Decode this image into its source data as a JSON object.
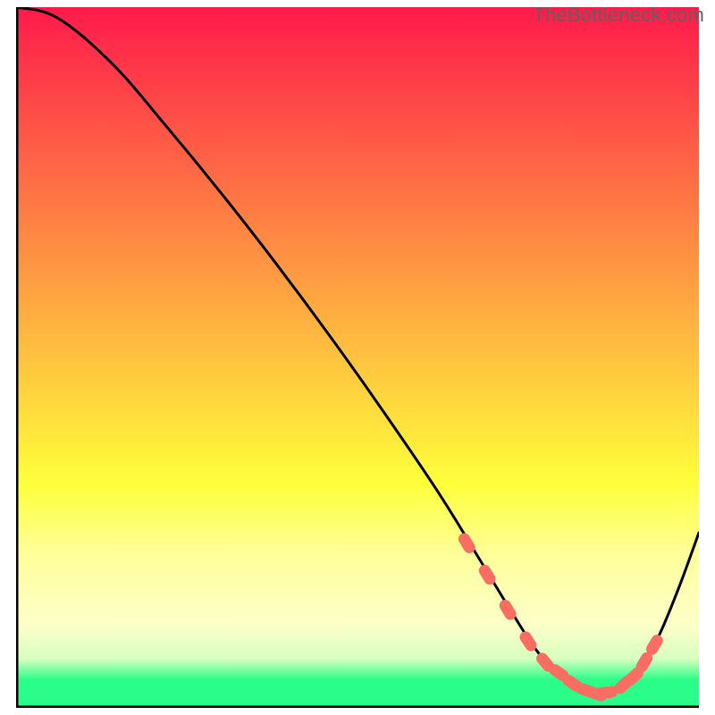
{
  "watermark": "TheBottleneck.com",
  "colors": {
    "red": "#ff1a4b",
    "orange": "#ffa632",
    "yellow": "#ffff3b",
    "paleyellow": "#ffff9a",
    "paleyellow2": "#fdffc8",
    "palegreen": "#d7ffbf",
    "green": "#2bfd8a",
    "axis": "#000000",
    "curve": "#000000",
    "marker": "#f96d62"
  },
  "chart_data": {
    "type": "line",
    "title": "",
    "xlabel": "",
    "ylabel": "",
    "xlim": [
      0,
      100
    ],
    "ylim": [
      0,
      100
    ],
    "curve": {
      "x": [
        0,
        6,
        14,
        22,
        30,
        38,
        46,
        54,
        62,
        68,
        73,
        76,
        79,
        82,
        85,
        88,
        91,
        94,
        97,
        100
      ],
      "y": [
        100,
        98.5,
        92,
        83,
        73.5,
        63.5,
        53,
        42,
        30.5,
        21,
        13,
        8.5,
        5,
        3,
        2,
        2.3,
        5,
        10,
        17,
        25
      ]
    },
    "markers": {
      "x": [
        66,
        69,
        72,
        75,
        77.5,
        79.5,
        81.5,
        83.5,
        85,
        86.5,
        89,
        90.5,
        92,
        93.5
      ],
      "y": [
        23.5,
        19,
        14,
        9.5,
        6.5,
        5,
        3.5,
        2.5,
        2,
        2.2,
        3.3,
        4.5,
        6.5,
        9
      ]
    },
    "gradient_bands": [
      {
        "y0": 0,
        "y1": 68,
        "c0": "red",
        "c1": "yellow"
      },
      {
        "y0": 68,
        "y1": 78,
        "c0": "yellow",
        "c1": "paleyellow"
      },
      {
        "y0": 78,
        "y1": 88,
        "c0": "paleyellow",
        "c1": "paleyellow2"
      },
      {
        "y0": 88,
        "y1": 93,
        "c0": "paleyellow2",
        "c1": "palegreen"
      },
      {
        "y0": 93,
        "y1": 96,
        "c0": "palegreen",
        "c1": "green"
      },
      {
        "y0": 96,
        "y1": 100,
        "c0": "green",
        "c1": "green"
      }
    ]
  }
}
